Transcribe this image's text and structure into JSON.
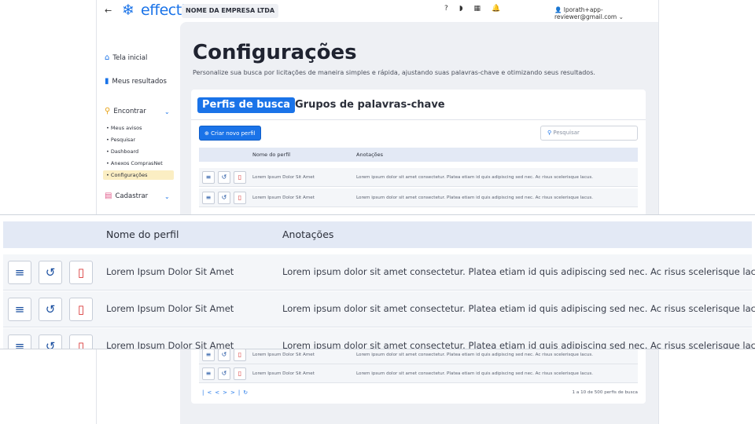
{
  "header": {
    "brand": "effecti",
    "company": "NOME DA EMPRESA LTDA",
    "user_email": "lporath+app-reviewer@gmail.com",
    "icons": [
      "help-icon",
      "rss-icon",
      "grid-icon",
      "bell-icon",
      "user-icon"
    ]
  },
  "sidebar": {
    "home": "Tela inicial",
    "results": "Meus resultados",
    "find": "Encontrar",
    "find_items": [
      "• Meus avisos",
      "• Pesquisar",
      "• Dashboard",
      "• Anexos ComprasNet",
      "• Configurações"
    ],
    "register": "Cadastrar"
  },
  "page": {
    "title": "Configurações",
    "subtitle": "Personalize sua busca por licitações de maneira simples e rápida, ajustando suas palavras-chave e otimizando seus resultados."
  },
  "tabs": {
    "active": "Perfis de busca",
    "other": "Grupos de palavras-chave"
  },
  "toolbar": {
    "create_label": "Criar novo perfil",
    "search_placeholder": "Pesquisar"
  },
  "table": {
    "col_name": "Nome do perfil",
    "col_notes": "Anotações",
    "rows": [
      {
        "name": "Lorem Ipsum Dolor Sit Amet",
        "notes": "Lorem ipsum dolor sit amet consectetur. Platea etiam id quis adipiscing sed nec. Ac risus scelerisque lacus."
      },
      {
        "name": "Lorem Ipsum Dolor Sit Amet",
        "notes": "Lorem ipsum dolor sit amet consectetur. Platea etiam id quis adipiscing sed nec. Ac risus scelerisque lacus."
      },
      {
        "name": "Lorem Ipsum Dolor Sit Amet",
        "notes": "Lorem ipsum dolor sit amet consectetur. Platea etiam id quis adipiscing sed nec. Ac risus scelerisque lacus."
      },
      {
        "name": "Lorem Ipsum Dolor Sit Amet",
        "notes": "Lorem ipsum dolor sit amet consectetur. Platea etiam id quis adipiscing sed nec. Ac risus scelerisque lacus."
      },
      {
        "name": "Lorem Ipsum Dolor Sit Amet",
        "notes": "Lorem ipsum dolor sit amet consectetur. Platea etiam id quis adipiscing sed nec. Ac risus scelerisque lacus."
      }
    ]
  },
  "pagination": {
    "info": "1 a 10 de 500 perfis de busca"
  },
  "colors": {
    "accent": "#1a73e8",
    "delete": "#d93636",
    "active_nav": "#fbeec3"
  }
}
